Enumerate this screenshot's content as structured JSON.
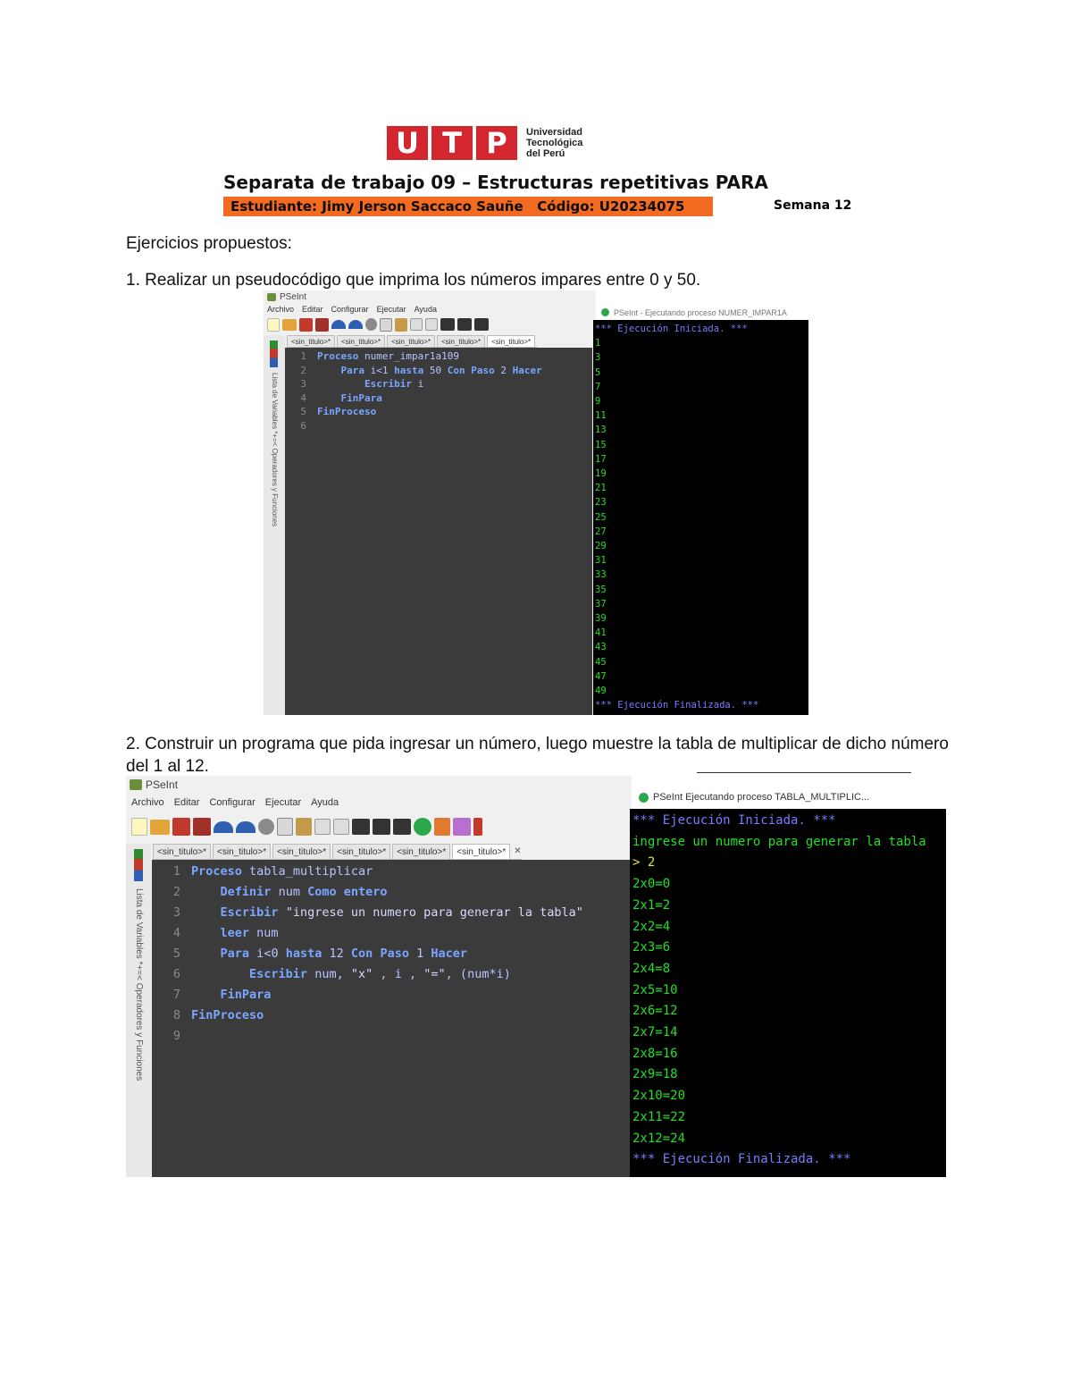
{
  "header": {
    "logo_letters": [
      "U",
      "T",
      "P"
    ],
    "logo_text_lines": [
      "Universidad",
      "Tecnológica",
      "del Perú"
    ],
    "title": "Separata de trabajo 09 – Estructuras repetitivas PARA",
    "student_line": "Estudiante: Jimy Jerson Saccaco Sauñe   Código: U20234075",
    "week": "Semana 12",
    "colors": {
      "logo_red": "#d3262e",
      "student_bar": "#f26b21"
    }
  },
  "intro": "Ejercicios propuestos:",
  "exercise1": {
    "statement": "1. Realizar un pseudocódigo que imprima los números impares entre 0 y 50.",
    "window_title": "PSeInt",
    "menu": [
      "Archivo",
      "Editar",
      "Configurar",
      "Ejecutar",
      "Ayuda"
    ],
    "tabs": [
      "<sin_titulo>*",
      "<sin_titulo>*",
      "<sin_titulo>*",
      "<sin_titulo>*",
      "<sin_titulo>*"
    ],
    "side_label": "Lista de Variables   *+=< Operadores y Funciones",
    "code": [
      {
        "n": "1",
        "text": "Proceso numer_impar1a109"
      },
      {
        "n": "2",
        "text": "    Para i<1 hasta 50 Con Paso 2 Hacer"
      },
      {
        "n": "3",
        "text": "        Escribir i"
      },
      {
        "n": "4",
        "text": "    FinPara"
      },
      {
        "n": "5",
        "text": "FinProceso"
      },
      {
        "n": "6",
        "text": ""
      }
    ],
    "console_title": "PSeInt - Ejecutando proceso NUMER_IMPAR1A",
    "console_start": "*** Ejecución Iniciada. ***",
    "console_output": [
      "1",
      "3",
      "5",
      "7",
      "9",
      "11",
      "13",
      "15",
      "17",
      "19",
      "21",
      "23",
      "25",
      "27",
      "29",
      "31",
      "33",
      "35",
      "37",
      "39",
      "41",
      "43",
      "45",
      "47",
      "49"
    ],
    "console_end": "*** Ejecución Finalizada. ***"
  },
  "exercise2": {
    "statement": "2. Construir un programa que pida ingresar un número, luego muestre la tabla de multiplicar de dicho número del 1 al 12.",
    "window_title": "PSeInt",
    "menu": [
      "Archivo",
      "Editar",
      "Configurar",
      "Ejecutar",
      "Ayuda"
    ],
    "tabs": [
      "<sin_titulo>*",
      "<sin_titulo>*",
      "<sin_titulo>*",
      "<sin_titulo>*",
      "<sin_titulo>*",
      "<sin_titulo>*"
    ],
    "side_label": "Lista de Variables   *+=< Operadores y Funciones",
    "code": [
      {
        "n": "1",
        "text": "Proceso tabla_multiplicar"
      },
      {
        "n": "2",
        "text": "    Definir num Como entero"
      },
      {
        "n": "3",
        "text": "    Escribir \"ingrese un numero para generar la tabla\""
      },
      {
        "n": "4",
        "text": "    leer num"
      },
      {
        "n": "5",
        "text": "    Para i<0 hasta 12 Con Paso 1 Hacer"
      },
      {
        "n": "6",
        "text": "        Escribir num, \"x\" , i , \"=\", (num*i)"
      },
      {
        "n": "7",
        "text": "    FinPara"
      },
      {
        "n": "8",
        "text": "FinProceso"
      },
      {
        "n": "9",
        "text": ""
      }
    ],
    "console_title": "PSeInt   Ejecutando proceso TABLA_MULTIPLIC...",
    "console_start": "*** Ejecución Iniciada. ***",
    "console_prompt": "ingrese un numero para generar la tabla",
    "console_input": "> 2",
    "console_output": [
      "2x0=0",
      "2x1=2",
      "2x2=4",
      "2x3=6",
      "2x4=8",
      "2x5=10",
      "2x6=12",
      "2x7=14",
      "2x8=16",
      "2x9=18",
      "2x10=20",
      "2x11=22",
      "2x12=24"
    ],
    "console_end": "*** Ejecución Finalizada. ***"
  }
}
